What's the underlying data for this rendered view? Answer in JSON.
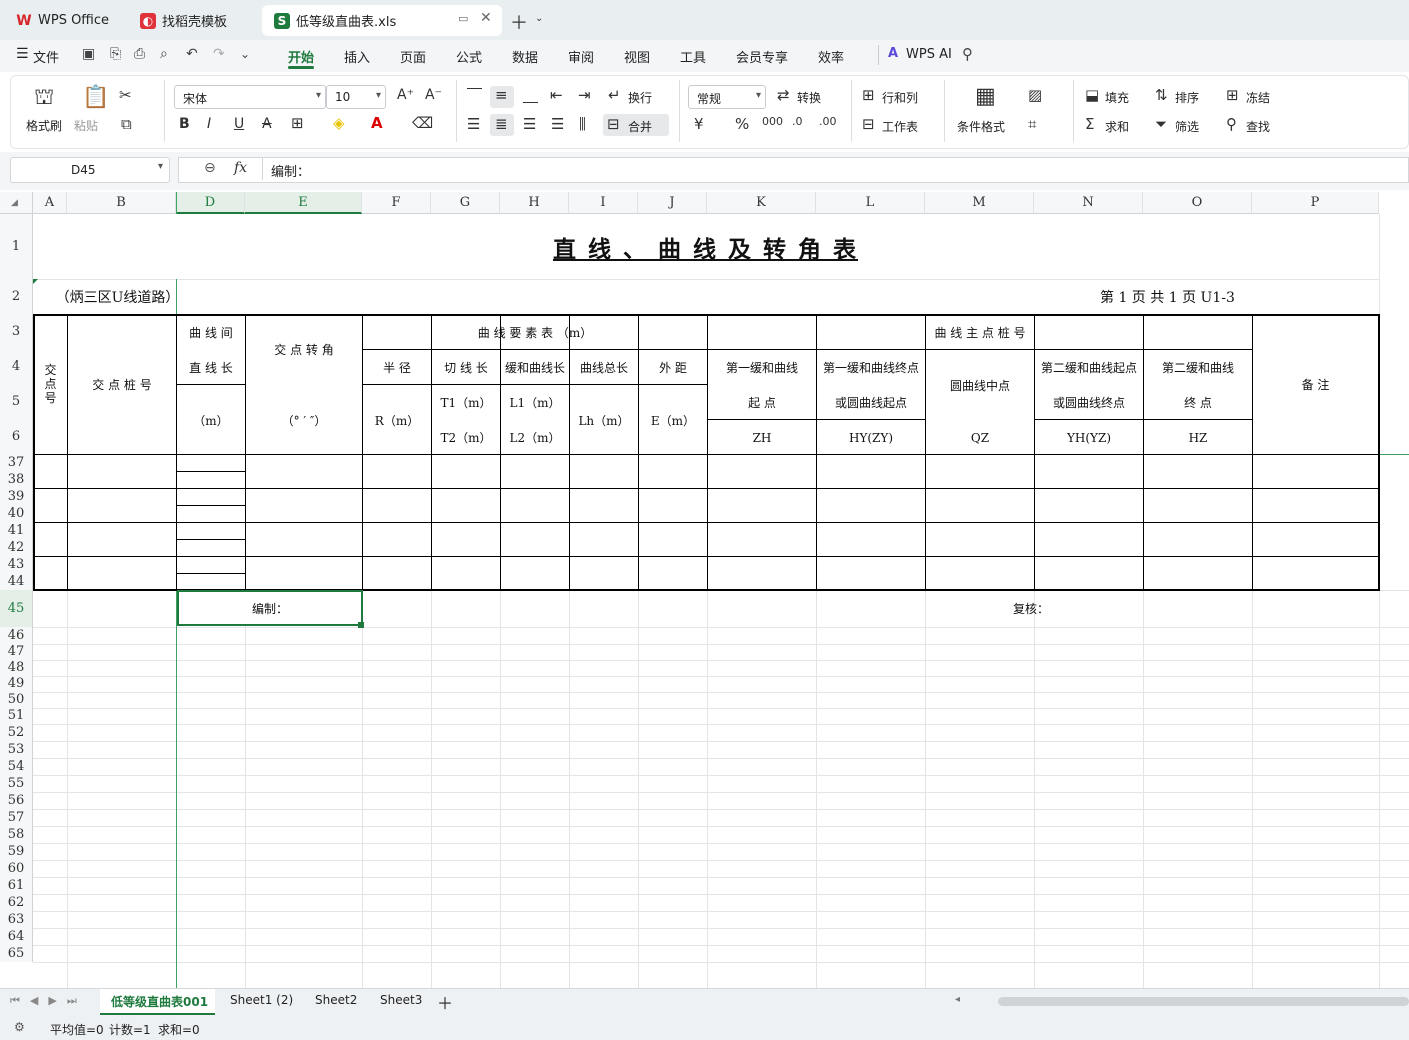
{
  "tabs": [
    {
      "label": "WPS Office",
      "icon": "wps-logo-icon",
      "active": false
    },
    {
      "label": "找稻壳模板",
      "icon": "docer-icon",
      "active": false
    },
    {
      "label": "低等级直曲表.xls",
      "icon": "sheet-icon",
      "active": true
    }
  ],
  "menu": {
    "file": "文件",
    "items": [
      "开始",
      "插入",
      "页面",
      "公式",
      "数据",
      "审阅",
      "视图",
      "工具",
      "会员专享",
      "效率"
    ],
    "active": "开始",
    "ai": "WPS AI"
  },
  "ribbon": {
    "format_painter": "格式刷",
    "paste": "粘贴",
    "font_name": "宋体",
    "font_size": "10",
    "wrap": "换行",
    "merge": "合并",
    "number_format": "常规",
    "convert": "转换",
    "row_col": "行和列",
    "worksheet": "工作表",
    "cond_format": "条件格式",
    "fill": "填充",
    "sort": "排序",
    "freeze": "冻结",
    "sum": "求和",
    "filter": "筛选",
    "find": "查找"
  },
  "formula_bar": {
    "name_box": "D45",
    "fx": "fx",
    "content": "编制："
  },
  "colors": {
    "accent": "#1f7a3e",
    "selection": "#e3efe7"
  },
  "columns": [
    "A",
    "B",
    "D",
    "E",
    "F",
    "G",
    "H",
    "I",
    "J",
    "K",
    "L",
    "M",
    "N",
    "O",
    "P"
  ],
  "rows": [
    "1",
    "2",
    "3",
    "4",
    "5",
    "6",
    "37",
    "38",
    "39",
    "40",
    "41",
    "42",
    "43",
    "44",
    "45",
    "46",
    "47",
    "48",
    "49",
    "50",
    "51",
    "52",
    "53",
    "54",
    "55",
    "56",
    "57",
    "58",
    "59",
    "60",
    "61",
    "62",
    "63",
    "64",
    "65"
  ],
  "sheet": {
    "title": "直 线 、 曲 线 及 转 角 表",
    "subtitle_left": "（炳三区U线道路）",
    "page_info": "第 1 页   共 1 页   U1-3",
    "h_jd": "交点号",
    "h_jdzh": "交  点  桩  号",
    "h_qxj1": "曲 线 间",
    "h_qxj2": "直 线 长",
    "h_qxj_unit": "（m）",
    "h_jdzj": "交 点 转 角",
    "h_jdzj_unit": "（° ′ ″）",
    "h_qxys": "曲    线    要    素    表 （m）",
    "h_bj": "半  径",
    "h_bj_unit": "R（m）",
    "h_qxc": "切 线 长",
    "h_t1": "T1（m）",
    "h_t2": "T2（m）",
    "h_hh": "缓和曲线长",
    "h_l1": "L1（m）",
    "h_l2": "L2（m）",
    "h_zc": "曲线总长",
    "h_lh": "Lh（m）",
    "h_wj": "外  距",
    "h_e": "E（m）",
    "h_zdzh": "曲      线      主      点      桩      号",
    "h_k1": "第一缓和曲线",
    "h_k2": "起        点",
    "h_k3": "ZH",
    "h_l1a": "第一缓和曲线终点",
    "h_l1b": "或圆曲线起点",
    "h_l1c": "HY(ZY)",
    "h_m1": "圆曲线中点",
    "h_m2": "QZ",
    "h_n1": "第二缓和曲线起点",
    "h_n2": "或圆曲线终点",
    "h_n3": "YH(YZ)",
    "h_o1": "第二缓和曲线",
    "h_o2": "终        点",
    "h_o3": "HZ",
    "h_bz": "备    注",
    "bianzhi": "编制：",
    "fuhe": "复核："
  },
  "sheet_tabs": [
    "低等级直曲表001",
    "Sheet1 (2)",
    "Sheet2",
    "Sheet3"
  ],
  "active_sheet": "低等级直曲表001",
  "status": {
    "avg": "平均值=0",
    "count": "计数=1",
    "sum": "求和=0"
  }
}
